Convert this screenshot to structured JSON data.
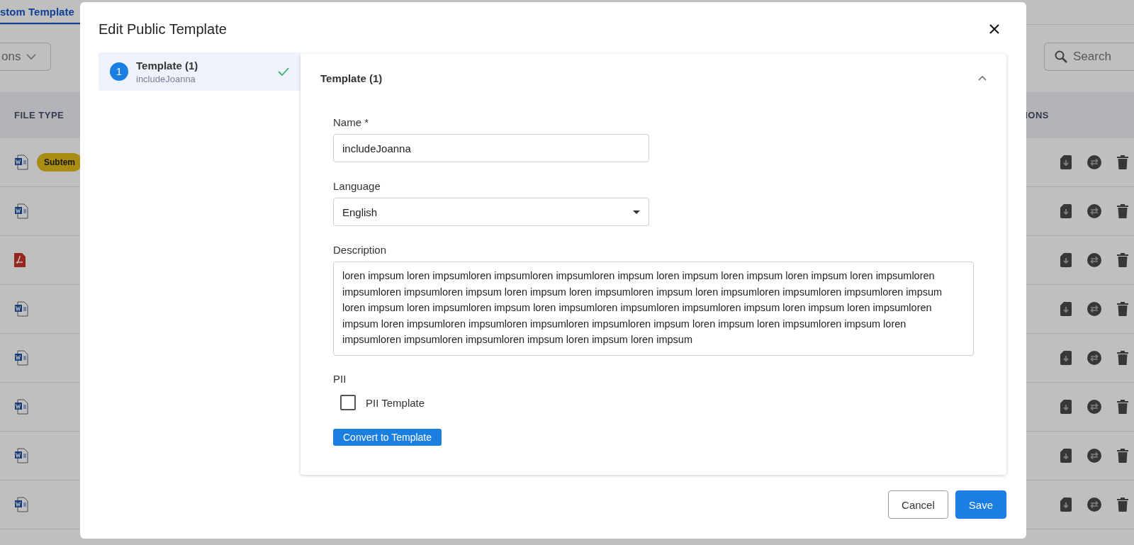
{
  "background": {
    "tabs": [
      {
        "label": "stom Template",
        "selected": true
      }
    ],
    "toolbar": {
      "dropdown": "ons",
      "search_placeholder": "Search"
    },
    "table": {
      "columns": [
        "FILE TYPE",
        "IONS"
      ],
      "rows": [
        {
          "kind": "word",
          "badge": "Subtem"
        },
        {
          "kind": "word"
        },
        {
          "kind": "pdf"
        },
        {
          "kind": "word"
        },
        {
          "kind": "word"
        },
        {
          "kind": "word"
        },
        {
          "kind": "word"
        },
        {
          "kind": "word"
        }
      ]
    }
  },
  "dialog": {
    "title": "Edit Public Template",
    "steps": [
      {
        "number": "1",
        "title": "Template (1)",
        "subtitle": "includeJoanna",
        "completed": true,
        "selected": true
      }
    ],
    "section": {
      "title": "Template (1)",
      "expanded": true
    },
    "name": {
      "label": "Name",
      "required_mark": "*",
      "value": "includeJoanna"
    },
    "language": {
      "label": "Language",
      "value": "English"
    },
    "description": {
      "label": "Description",
      "value": "loren impsum loren impsumloren impsumloren impsumloren impsum loren impsum loren impsum loren impsum loren impsumloren impsumloren impsumloren impsum loren impsum loren impsumloren impsum loren impsumloren impsumloren impsumloren impsum loren impsum loren impsumloren impsum loren impsumloren impsumloren impsumloren impsum loren impsum loren impsumloren impsum loren impsumloren impsumloren impsumloren impsumloren impsum loren impsum loren impsumloren impsum loren impsumloren impsumloren impsumloren impsum loren impsum loren impsum"
    },
    "pii": {
      "label": "PII",
      "checkbox_label": "PII Template",
      "checked": false
    },
    "convert_button": "Convert to Template",
    "buttons": [
      {
        "label": "Cancel",
        "kind": "secondary"
      },
      {
        "label": "Save",
        "kind": "primary"
      }
    ]
  }
}
